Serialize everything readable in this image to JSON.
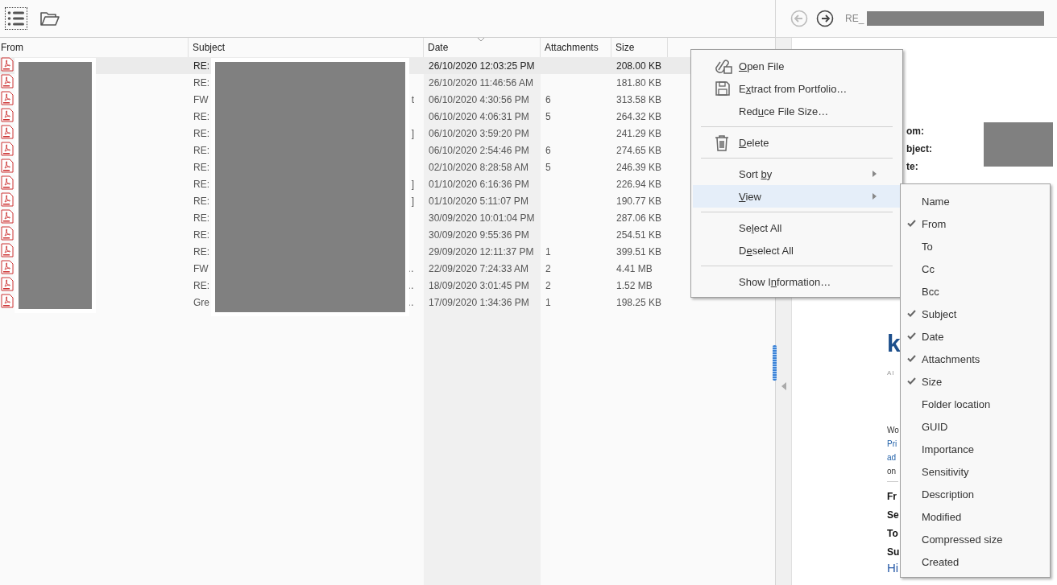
{
  "toolbar": {
    "buttons": [
      {
        "kind": "list",
        "focused": true
      },
      {
        "kind": "folder",
        "focused": false
      }
    ]
  },
  "table": {
    "columns": [
      {
        "label": "From",
        "sorted": false
      },
      {
        "label": "Subject",
        "sorted": false
      },
      {
        "label": "Date",
        "sorted": true
      },
      {
        "label": "Attachments",
        "sorted": false
      },
      {
        "label": "Size",
        "sorted": false
      }
    ],
    "rows": [
      {
        "subject_start": "RE:",
        "date": "26/10/2020 12:03:25 PM",
        "size": "208.00 KB",
        "selected": true
      },
      {
        "subject_start": "RE:",
        "date": "26/10/2020 11:46:56 AM",
        "size": "181.80 KB",
        "selected": false
      },
      {
        "subject_start": "FW",
        "subject_end": "t",
        "date": "06/10/2020 4:30:56 PM",
        "attachments": "6",
        "size": "313.58 KB",
        "selected": false
      },
      {
        "subject_start": "RE:",
        "date": "06/10/2020 4:06:31 PM",
        "attachments": "5",
        "size": "264.32 KB",
        "selected": false
      },
      {
        "subject_start": "RE:",
        "subject_end": "]",
        "date": "06/10/2020 3:59:20 PM",
        "size": "241.29 KB",
        "selected": false
      },
      {
        "subject_start": "RE:",
        "date": "06/10/2020 2:54:46 PM",
        "attachments": "6",
        "size": "274.65 KB",
        "selected": false
      },
      {
        "subject_start": "RE:",
        "date": "02/10/2020 8:28:58 AM",
        "attachments": "5",
        "size": "246.39 KB",
        "selected": false
      },
      {
        "subject_start": "RE:",
        "subject_end": "]",
        "date": "01/10/2020 6:16:36 PM",
        "size": "226.94 KB",
        "selected": false
      },
      {
        "subject_start": "RE:",
        "subject_end": "]",
        "date": "01/10/2020 5:11:07 PM",
        "size": "190.77 KB",
        "selected": false
      },
      {
        "subject_start": "RE:",
        "date": "30/09/2020 10:01:04 PM",
        "size": "287.06 KB",
        "selected": false
      },
      {
        "subject_start": "RE:",
        "date": "30/09/2020 9:55:36 PM",
        "size": "254.51 KB",
        "selected": false
      },
      {
        "subject_start": "RE:",
        "date": "29/09/2020 12:11:37 PM",
        "attachments": "1",
        "size": "399.51 KB",
        "selected": false
      },
      {
        "subject_start": "FW",
        "subject_end": "…",
        "date": "22/09/2020 7:24:33 AM",
        "attachments": "2",
        "size": "4.41 MB",
        "selected": false
      },
      {
        "subject_start": "RE:",
        "subject_end": "…",
        "date": "18/09/2020 3:01:45 PM",
        "attachments": "2",
        "size": "1.52 MB",
        "selected": false
      },
      {
        "subject_start": "Gre",
        "subject_end": "…",
        "date": "17/09/2020 1:34:36 PM",
        "attachments": "1",
        "size": "198.25 KB",
        "selected": false
      }
    ]
  },
  "preview": {
    "nav": [
      {
        "kind": "back",
        "disabled": true
      },
      {
        "kind": "forward",
        "disabled": false
      }
    ],
    "title_prefix": "RE_",
    "header_labels": [
      "om:",
      "bject:",
      "te:"
    ],
    "logo": "k",
    "logo_sub": "AI",
    "notice_lines": [
      {
        "start": "Wo"
      },
      {
        "start": "Pri"
      },
      {
        "start": "ad"
      },
      {
        "start": "on"
      }
    ],
    "fields": [
      {
        "start": "Fr"
      },
      {
        "start": "Se"
      },
      {
        "start": "To"
      },
      {
        "start": "Su"
      }
    ],
    "greeting": "Hi"
  },
  "context_menu": {
    "items": [
      {
        "kind": "open",
        "key": "O",
        "label_post": "pen File",
        "selected": false
      },
      {
        "kind": "extract",
        "label_pre": "E",
        "key": "x",
        "label_post": "tract from Portfolio…",
        "selected": false
      },
      {
        "kind": "plain",
        "label_pre": "Red",
        "key": "u",
        "label_post": "ce File Size…",
        "selected": false
      },
      {
        "kind": "separator"
      },
      {
        "kind": "delete",
        "key": "D",
        "label_post": "elete",
        "selected": false
      },
      {
        "kind": "separator"
      },
      {
        "kind": "submenu",
        "label_pre": "Sort ",
        "key": "b",
        "label_post": "y",
        "selected": false
      },
      {
        "kind": "submenu",
        "key": "V",
        "label_post": "iew",
        "selected": true
      },
      {
        "kind": "separator"
      },
      {
        "kind": "plain",
        "label_pre": "Se",
        "key": "l",
        "label_post": "ect All",
        "selected": false
      },
      {
        "kind": "plain",
        "label_pre": "D",
        "key": "e",
        "label_post": "select All",
        "selected": false
      },
      {
        "kind": "separator"
      },
      {
        "kind": "plain",
        "label_pre": "Show I",
        "key": "n",
        "label_post": "formation…",
        "selected": false
      }
    ]
  },
  "view_submenu": {
    "items": [
      {
        "label": "Name",
        "checked": false
      },
      {
        "label": "From",
        "checked": true
      },
      {
        "label": "To",
        "checked": false
      },
      {
        "label": "Cc",
        "checked": false
      },
      {
        "label": "Bcc",
        "checked": false
      },
      {
        "label": "Subject",
        "checked": true
      },
      {
        "label": "Date",
        "checked": true
      },
      {
        "label": "Attachments",
        "checked": true
      },
      {
        "label": "Size",
        "checked": true
      },
      {
        "label": "Folder location",
        "checked": false
      },
      {
        "label": "GUID",
        "checked": false
      },
      {
        "label": "Importance",
        "checked": false
      },
      {
        "label": "Sensitivity",
        "checked": false
      },
      {
        "label": "Description",
        "checked": false
      },
      {
        "label": "Modified",
        "checked": false
      },
      {
        "label": "Compressed size",
        "checked": false
      },
      {
        "label": "Created",
        "checked": false
      }
    ]
  }
}
